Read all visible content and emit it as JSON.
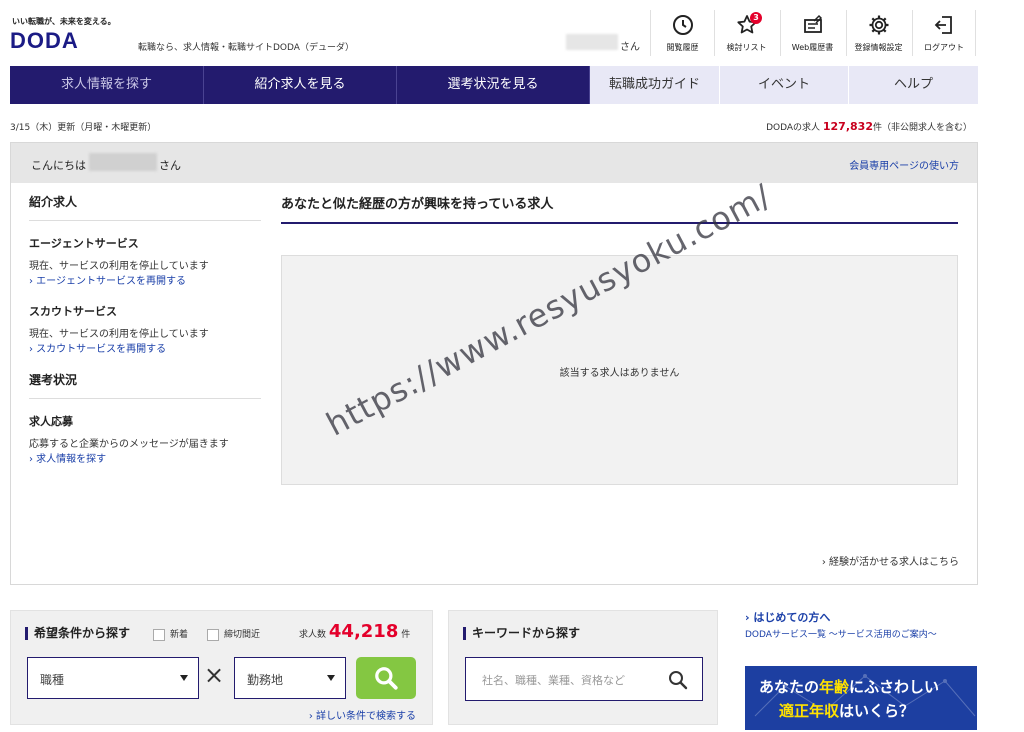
{
  "header": {
    "tagline": "いい転職が、未来を変える。",
    "logo": "DODA",
    "logo_sub": "転職なら、求人情報・転職サイトDODA（デューダ）",
    "user_suffix": "さん",
    "nav": [
      {
        "label": "閲覧履歴",
        "icon": "clock-icon"
      },
      {
        "label": "検討リスト",
        "icon": "star-icon",
        "badge": "3"
      },
      {
        "label": "Web履歴書",
        "icon": "resume-icon"
      },
      {
        "label": "登録情報設定",
        "icon": "gear-icon"
      },
      {
        "label": "ログアウト",
        "icon": "logout-icon"
      }
    ]
  },
  "main_nav": [
    {
      "label": "求人情報を探す"
    },
    {
      "label": "紹介求人を見る"
    },
    {
      "label": "選考状況を見る"
    },
    {
      "label": "転職成功ガイド"
    },
    {
      "label": "イベント"
    },
    {
      "label": "ヘルプ"
    }
  ],
  "status": {
    "update": "3/15（木）更新（月曜・木曜更新）",
    "jobs_prefix": "DODAの求人 ",
    "jobs_count": "127,832",
    "jobs_suffix": "件（非公開求人を含む）"
  },
  "greeting": {
    "hello": "こんにちは",
    "san": "さん",
    "guide_link": "会員専用ページの使い方"
  },
  "sidebar": {
    "section1": "紹介求人",
    "agent_title": "エージェントサービス",
    "agent_desc": "現在、サービスの利用を停止しています",
    "agent_link": "› エージェントサービスを再開する",
    "scout_title": "スカウトサービス",
    "scout_desc": "現在、サービスの利用を停止しています",
    "scout_link": "› スカウトサービスを再開する",
    "section2": "選考状況",
    "apply_title": "求人応募",
    "apply_desc": "応募すると企業からのメッセージが届きます",
    "apply_link": "› 求人情報を探す"
  },
  "content": {
    "title": "あなたと似た経歴の方が興味を持っている求人",
    "empty_msg": "該当する求人はありません",
    "more_link": "› 経験が活かせる求人はこちら"
  },
  "condition_search": {
    "title": "希望条件から探す",
    "check_new": "新着",
    "check_deadline": "締切間近",
    "count_label": "求人数",
    "count_value": "44,218",
    "count_unit": "件",
    "select_job": "職種",
    "select_location": "勤務地",
    "times": "×",
    "advanced_link": "› 詳しい条件で検索する"
  },
  "keyword_search": {
    "title": "キーワードから探す",
    "placeholder": "社名、職種、業種、資格など"
  },
  "right": {
    "first_time": "› はじめての方へ",
    "service_list": "DODAサービス一覧 ～サービス活用のご案内～",
    "banner_l1_a": "あなたの",
    "banner_l1_b": "年齢",
    "banner_l1_c": "にふさわしい",
    "banner_l2_a": "適正年収",
    "banner_l2_b": "はいくら？"
  },
  "watermark": "https://www.resyusyoku.com/",
  "colors": {
    "brand": "#231b6e",
    "accent_red": "#e4002b",
    "go_green": "#84c742",
    "link": "#1a3fa8"
  }
}
